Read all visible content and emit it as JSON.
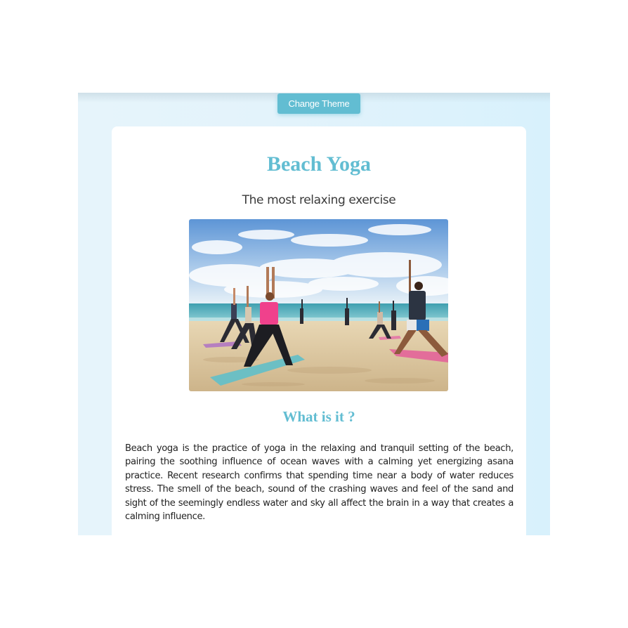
{
  "toolbar": {
    "change_theme_label": "Change Theme"
  },
  "page": {
    "title": "Beach Yoga",
    "subtitle": "The most relaxing exercise",
    "image_alt": "Group practicing yoga on a sandy beach",
    "section_heading": "What is it ?",
    "section_body": "Beach yoga is the practice of yoga in the relaxing and tranquil setting of the beach, pairing the soothing influence of ocean waves with a calming yet energizing asana practice. Recent research confirms that spending time near a body of water reduces stress. The smell of the beach, sound of the crashing waves and feel of the sand and sight of the seemingly endless water and sky all affect the brain in a way that creates a calming influence."
  },
  "colors": {
    "accent": "#62bdd2",
    "page_background": "#e3f3fb",
    "card_background": "#ffffff",
    "body_text": "#222222"
  }
}
